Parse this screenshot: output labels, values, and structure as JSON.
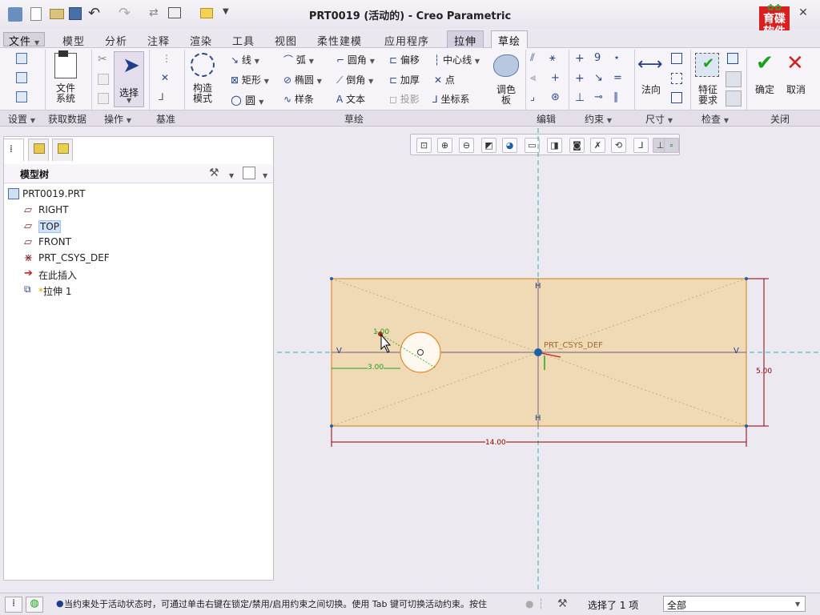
{
  "window": {
    "title": "PRT0019 (活动的) - Creo Parametric"
  },
  "logo": {
    "text_top": "育碟",
    "text_bottom": "软件"
  },
  "menu": {
    "file": "文件",
    "items": [
      "模型",
      "分析",
      "注释",
      "渲染",
      "工具",
      "视图",
      "柔性建模",
      "应用程序"
    ],
    "tab_extrude": "拉伸",
    "tab_sketch": "草绘"
  },
  "ribbon": {
    "file_system": "文件\n系统",
    "select": "选择",
    "construct_mode": "构造\n模式",
    "line": "线",
    "arc": "弧",
    "fillet": "圆角",
    "offset": "偏移",
    "centerline": "中心线",
    "rectangle": "矩形",
    "ellipse": "椭圆",
    "chamfer": "倒角",
    "thicken": "加厚",
    "point": "点",
    "circle": "圆",
    "spline": "样条",
    "text": "文本",
    "project": "投影",
    "coord_sys": "坐标系",
    "palette": "调色\n板",
    "normal": "法向",
    "feature_req": "特征\n要求",
    "ok": "确定",
    "cancel": "取消"
  },
  "groups": {
    "setup": "设置",
    "get_data": "获取数据",
    "operations": "操作",
    "datum": "基准",
    "sketch": "草绘",
    "edit": "编辑",
    "constrain": "约束",
    "dimension": "尺寸",
    "inspect": "检查",
    "close": "关闭"
  },
  "tree": {
    "header": "模型树",
    "items": [
      {
        "label": "PRT0019.PRT",
        "icon": "part-icon"
      },
      {
        "label": "RIGHT",
        "icon": "plane-icon"
      },
      {
        "label": "TOP",
        "icon": "plane-icon"
      },
      {
        "label": "FRONT",
        "icon": "plane-icon"
      },
      {
        "label": "PRT_CSYS_DEF",
        "icon": "csys-icon"
      },
      {
        "label": "在此插入",
        "icon": "insert-arrow-icon"
      },
      {
        "label": "拉伸 1",
        "icon": "extrude-icon"
      }
    ]
  },
  "sketch": {
    "csys_label": "PRT_CSYS_DEF",
    "dim_width": "14.00",
    "dim_height": "5.00",
    "dim_hole_offset": "3.00",
    "dim_radius": "1.00",
    "constraint_v": "V",
    "constraint_h": "H"
  },
  "status": {
    "message": "当约束处于活动状态时，可通过单击右键在锁定/禁用/启用约束之间切换。使用 Tab 键可切换活动约束。按住",
    "selected": "选择了 1 项",
    "filter": "全部"
  },
  "colors": {
    "accent_green": "#1aa31a",
    "cancel_red": "#d21f1f",
    "sketch_fill": "#f0d9b5",
    "sketch_edge": "#e08a2a",
    "dimension": "#8b0000",
    "cyan_axis": "#2fb3b3"
  }
}
